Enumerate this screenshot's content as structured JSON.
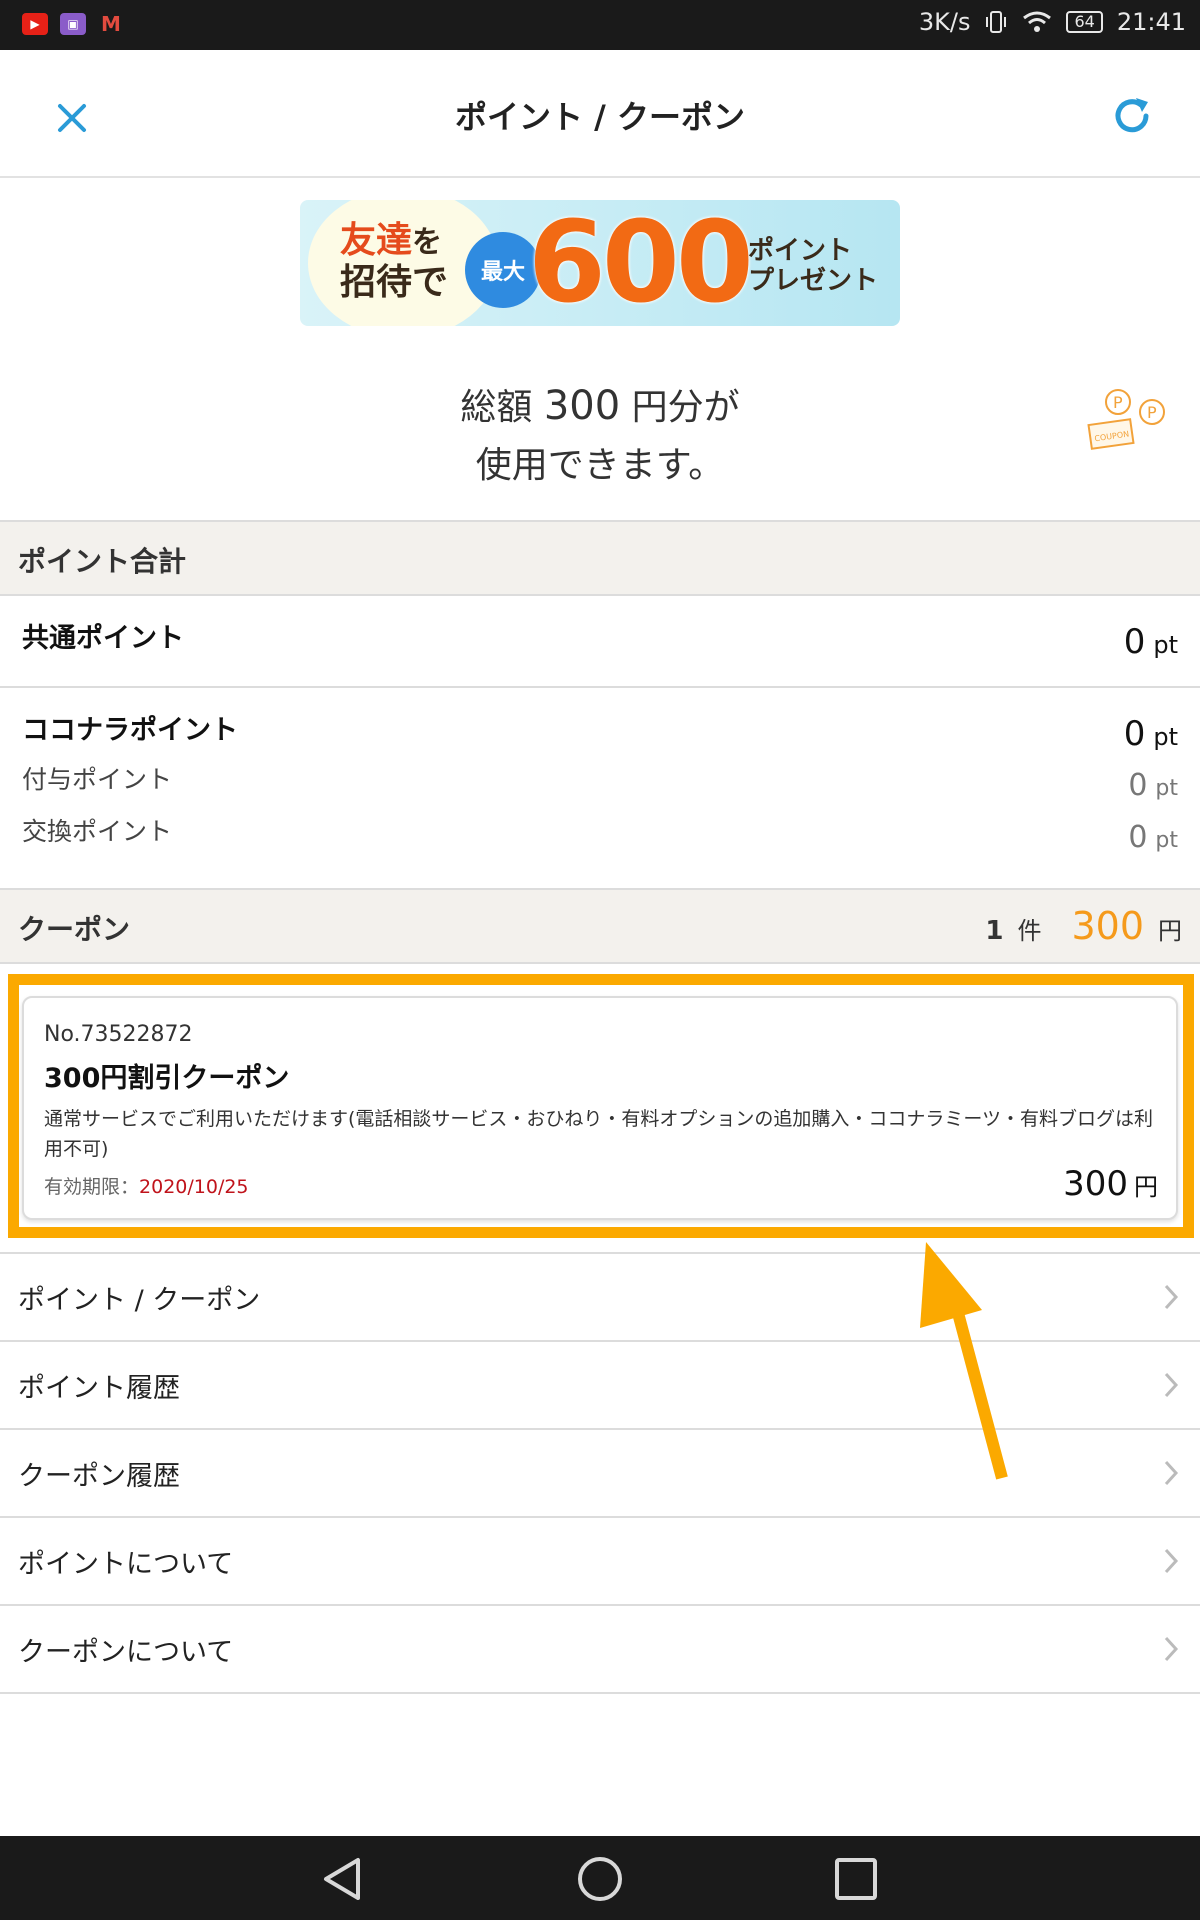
{
  "status_bar": {
    "speed": "3K/s",
    "battery": "64",
    "time": "21:41",
    "icons": [
      "youtube-icon",
      "gallery-icon",
      "gmail-icon",
      "vibrate-icon",
      "wifi-icon",
      "battery-icon"
    ]
  },
  "header": {
    "title": "ポイント / クーポン",
    "close_icon": "close-icon",
    "refresh_icon": "refresh-icon",
    "accent_color": "#2a9bd7"
  },
  "banner": {
    "line1_a": "友達",
    "line1_b": "を",
    "line2": "招待で",
    "badge": "最大",
    "number": "600",
    "line3_a": "ポイント",
    "line3_b": "プレゼント"
  },
  "total": {
    "prefix": "総額",
    "amount": "300",
    "suffix": "円分が",
    "line2": "使用できます。",
    "illustration_label": "COUPON"
  },
  "points_section": {
    "header": "ポイント合計",
    "common_label": "共通ポイント",
    "common_value": "0",
    "coconala_label": "ココナラポイント",
    "coconala_value": "0",
    "granted_label": "付与ポイント",
    "granted_value": "0",
    "exchange_label": "交換ポイント",
    "exchange_value": "0",
    "unit": "pt"
  },
  "coupon_section": {
    "header": "クーポン",
    "count": "1",
    "count_unit": "件",
    "amount": "300",
    "amount_unit": "円",
    "amount_color": "#f59a1b"
  },
  "coupon_card": {
    "number": "No.73522872",
    "name": "300円割引クーポン",
    "description": "通常サービスでご利用いただけます(電話相談サービス・おひねり・有料オプションの追加購入・ココナラミーツ・有料ブログは利用不可)",
    "expiry_label": "有効期限：",
    "expiry_date": "2020/10/25",
    "value": "300",
    "value_unit": "円",
    "highlight_color": "#fba900"
  },
  "menu": [
    {
      "label": "ポイント / クーポン"
    },
    {
      "label": "ポイント履歴"
    },
    {
      "label": "クーポン履歴"
    },
    {
      "label": "ポイントについて"
    },
    {
      "label": "クーポンについて"
    }
  ],
  "nav_bar": {
    "icons": [
      "back-icon",
      "home-icon",
      "recents-icon"
    ]
  }
}
